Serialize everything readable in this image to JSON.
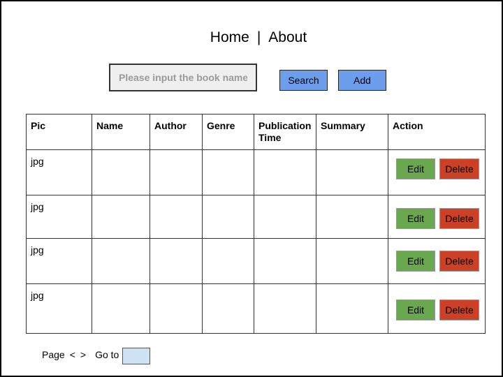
{
  "nav": {
    "home": "Home",
    "separator": "|",
    "about": "About"
  },
  "search": {
    "placeholder": "Please input the book name",
    "value": "",
    "search_label": "Search",
    "add_label": "Add"
  },
  "table": {
    "columns": [
      "Pic",
      "Name",
      "Author",
      "Genre",
      "Publication Time",
      "Summary",
      "Action"
    ],
    "rows": [
      {
        "pic": "jpg",
        "name": "",
        "author": "",
        "genre": "",
        "publication_time": "",
        "summary": ""
      },
      {
        "pic": "jpg",
        "name": "",
        "author": "",
        "genre": "",
        "publication_time": "",
        "summary": ""
      },
      {
        "pic": "jpg",
        "name": "",
        "author": "",
        "genre": "",
        "publication_time": "",
        "summary": ""
      },
      {
        "pic": "jpg",
        "name": "",
        "author": "",
        "genre": "",
        "publication_time": "",
        "summary": ""
      }
    ],
    "edit_label": "Edit",
    "delete_label": "Delete"
  },
  "pager": {
    "page_label": "Page",
    "prev": "<",
    "next": ">",
    "goto_label": "Go to",
    "goto_value": ""
  },
  "colors": {
    "primary_button": "#6d9eeb",
    "edit_button": "#6aa84f",
    "delete_button": "#cc4125",
    "page_input": "#cfe2f3"
  }
}
